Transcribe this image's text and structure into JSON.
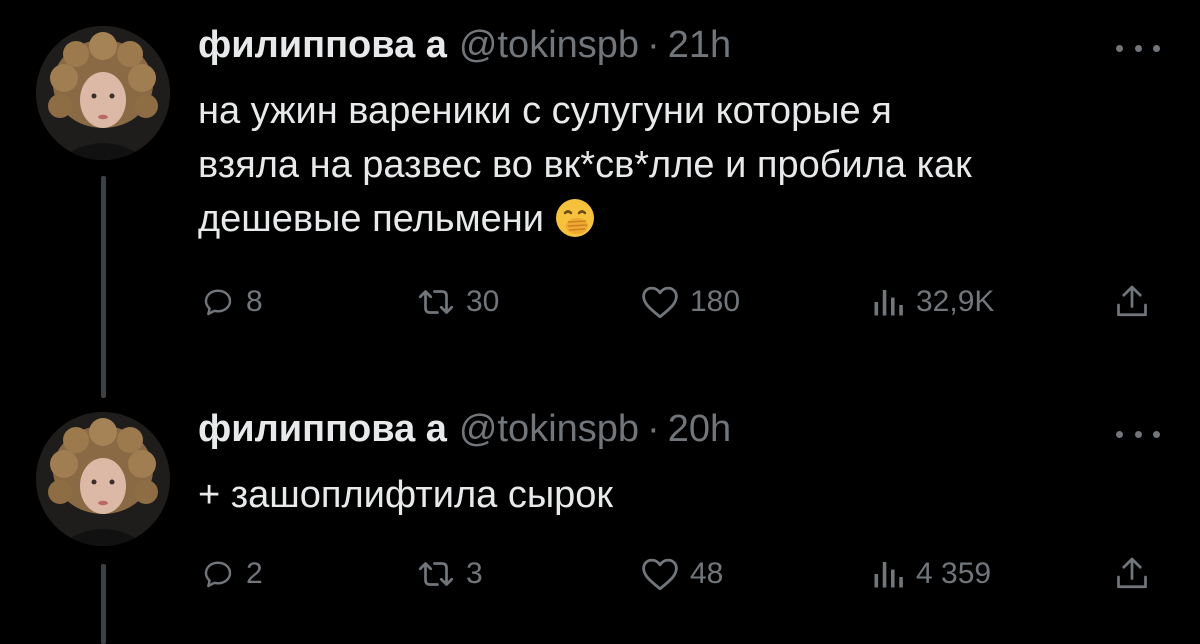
{
  "tweets": [
    {
      "author": {
        "display_name": "филиппова а",
        "handle": "@tokinspb",
        "separator": "·",
        "time": "21h"
      },
      "text_lines": [
        "на ужин вареники с сулугуни которые я",
        "взяла на развес во вк*св*лле и пробила как",
        "дешевые пельмени"
      ],
      "emoji": "face-with-hand-over-mouth",
      "metrics": {
        "replies": "8",
        "retweets": "30",
        "likes": "180",
        "views": "32,9K"
      }
    },
    {
      "author": {
        "display_name": "филиппова а",
        "handle": "@tokinspb",
        "separator": "·",
        "time": "20h"
      },
      "text_lines": [
        "+ зашоплифтила сырок"
      ],
      "metrics": {
        "replies": "2",
        "retweets": "3",
        "likes": "48",
        "views": "4 359"
      }
    }
  ],
  "icons": {
    "reply": "reply-icon",
    "retweet": "retweet-icon",
    "like": "heart-icon",
    "views": "views-icon",
    "share": "share-icon",
    "more": "more-options-icon"
  },
  "colors": {
    "background": "#000000",
    "text_primary": "#e7e9ea",
    "text_secondary": "#71767b",
    "thread_line": "#3e4144"
  }
}
